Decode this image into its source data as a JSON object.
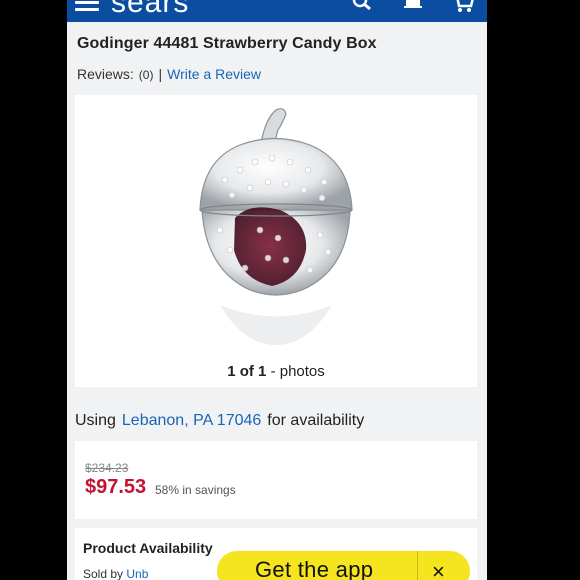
{
  "header": {
    "brand": "sears",
    "brand_color": "#0b4ea1"
  },
  "product": {
    "title": "Godinger 44481 Strawberry Candy Box",
    "reviews_label": "Reviews:",
    "review_count": "(0)",
    "separator": "|",
    "write_review": "Write a Review"
  },
  "gallery": {
    "current": "1 of 1",
    "suffix": " - photos"
  },
  "availability": {
    "prefix": "Using",
    "location": "Lebanon, PA 17046",
    "suffix": "for availability"
  },
  "pricing": {
    "original": "$234.23",
    "sale": "$97.53",
    "savings": "58% in savings",
    "sale_color": "#c41230"
  },
  "product_availability": {
    "title": "Product Availability",
    "sold_by_label": "Sold by",
    "sold_by_value": "Unb"
  },
  "app_banner": {
    "cta": "Get the app",
    "close": "×",
    "color": "#f5e41e"
  }
}
